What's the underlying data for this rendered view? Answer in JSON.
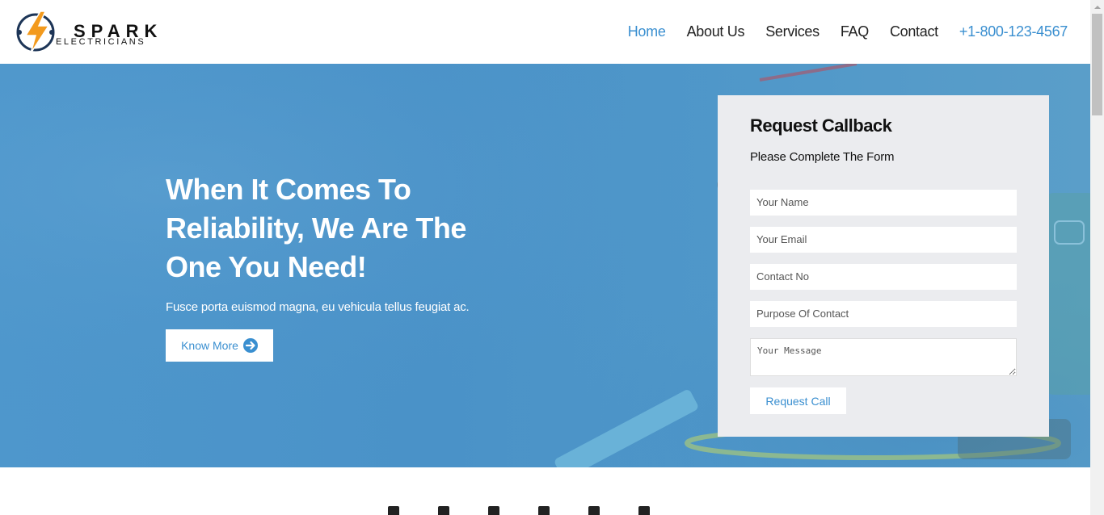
{
  "brand": {
    "name": "SPARK",
    "tagline": "ELECTRICIANS"
  },
  "nav": {
    "items": [
      {
        "label": "Home",
        "active": true
      },
      {
        "label": "About Us"
      },
      {
        "label": "Services"
      },
      {
        "label": "FAQ"
      },
      {
        "label": "Contact"
      }
    ],
    "phone": "+1-800-123-4567"
  },
  "hero": {
    "title": "When It Comes To Reliability, We Are The One You Need!",
    "subtitle": "Fusce porta euismod magna, eu vehicula tellus feugiat ac.",
    "cta_label": "Know More",
    "cta_icon": "arrow-right-circle-icon"
  },
  "callback_form": {
    "title": "Request Callback",
    "subtitle": "Please Complete The Form",
    "name_placeholder": "Your Name",
    "email_placeholder": "Your Email",
    "contact_placeholder": "Contact No",
    "purpose_placeholder": "Purpose Of Contact",
    "message_placeholder": "Your Message",
    "submit_label": "Request Call"
  },
  "colors": {
    "accent": "#3a8fd0",
    "hero_bg": "#4a92c8",
    "panel_bg": "#ebecef",
    "logo_orange": "#f39a1d",
    "logo_navy": "#1d3557"
  }
}
